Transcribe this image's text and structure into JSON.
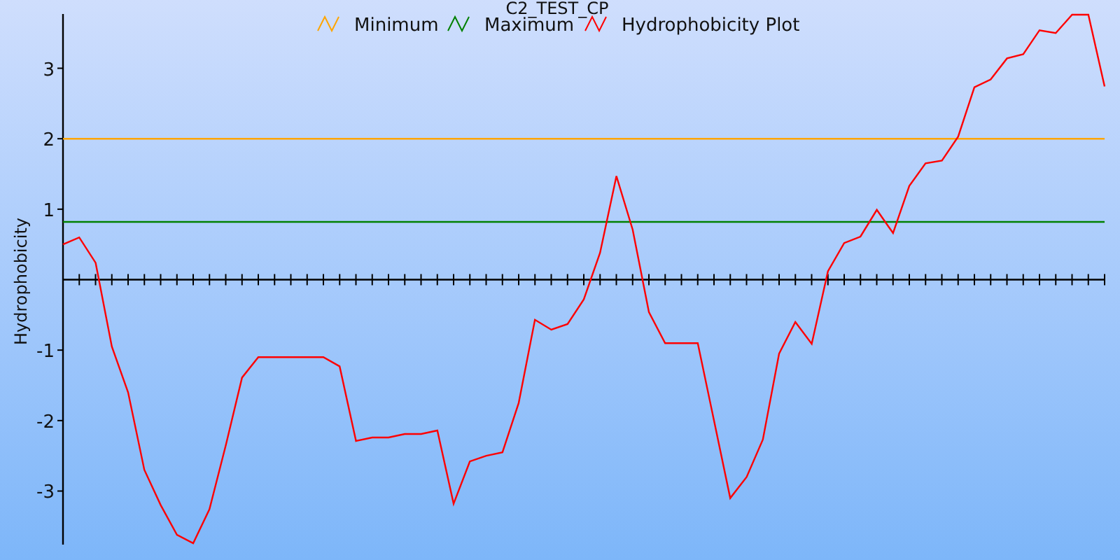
{
  "chart_data": {
    "type": "line",
    "title": "C2_TEST_CP",
    "legend": true,
    "ylabel": "Hydrophobicity",
    "ylim": [
      -3.76,
      3.77
    ],
    "yticks": [
      -3,
      -2,
      -1,
      1,
      2,
      3
    ],
    "series": [
      {
        "name": "Minimum",
        "color": "#ffa500",
        "values": [
          2,
          2,
          2,
          2,
          2,
          2,
          2,
          2,
          2,
          2,
          2,
          2,
          2,
          2,
          2,
          2,
          2,
          2,
          2,
          2,
          2,
          2,
          2,
          2,
          2,
          2,
          2,
          2,
          2,
          2,
          2,
          2,
          2,
          2,
          2,
          2,
          2,
          2,
          2,
          2,
          2,
          2,
          2,
          2,
          2,
          2,
          2,
          2,
          2,
          2,
          2,
          2,
          2,
          2,
          2,
          2,
          2,
          2,
          2,
          2,
          2,
          2,
          2,
          2,
          2
        ]
      },
      {
        "name": "Maximum",
        "color": "#008000",
        "values": [
          0.82,
          0.82,
          0.82,
          0.82,
          0.82,
          0.82,
          0.82,
          0.82,
          0.82,
          0.82,
          0.82,
          0.82,
          0.82,
          0.82,
          0.82,
          0.82,
          0.82,
          0.82,
          0.82,
          0.82,
          0.82,
          0.82,
          0.82,
          0.82,
          0.82,
          0.82,
          0.82,
          0.82,
          0.82,
          0.82,
          0.82,
          0.82,
          0.82,
          0.82,
          0.82,
          0.82,
          0.82,
          0.82,
          0.82,
          0.82,
          0.82,
          0.82,
          0.82,
          0.82,
          0.82,
          0.82,
          0.82,
          0.82,
          0.82,
          0.82,
          0.82,
          0.82,
          0.82,
          0.82,
          0.82,
          0.82,
          0.82,
          0.82,
          0.82,
          0.82,
          0.82,
          0.82,
          0.82,
          0.82,
          0.82
        ]
      },
      {
        "name": "Hydrophobicity Plot",
        "color": "#ff0000",
        "values": [
          0.5,
          0.6,
          0.24,
          -0.95,
          -1.6,
          -2.7,
          -3.2,
          -3.62,
          -3.74,
          -3.26,
          -2.35,
          -1.39,
          -1.1,
          -1.1,
          -1.1,
          -1.1,
          -1.1,
          -1.23,
          -2.29,
          -2.24,
          -2.24,
          -2.19,
          -2.19,
          -2.14,
          -3.18,
          -2.58,
          -2.5,
          -2.45,
          -1.75,
          -0.57,
          -0.71,
          -0.63,
          -0.28,
          0.38,
          1.47,
          0.71,
          -0.46,
          -0.9,
          -0.9,
          -0.9,
          -2.0,
          -3.1,
          -2.8,
          -2.27,
          -1.05,
          -0.6,
          -0.91,
          0.12,
          0.52,
          0.61,
          0.99,
          0.66,
          1.33,
          1.65,
          1.69,
          2.03,
          2.73,
          2.84,
          3.14,
          3.2,
          3.54,
          3.5,
          3.76,
          3.76,
          2.74
        ]
      }
    ]
  }
}
